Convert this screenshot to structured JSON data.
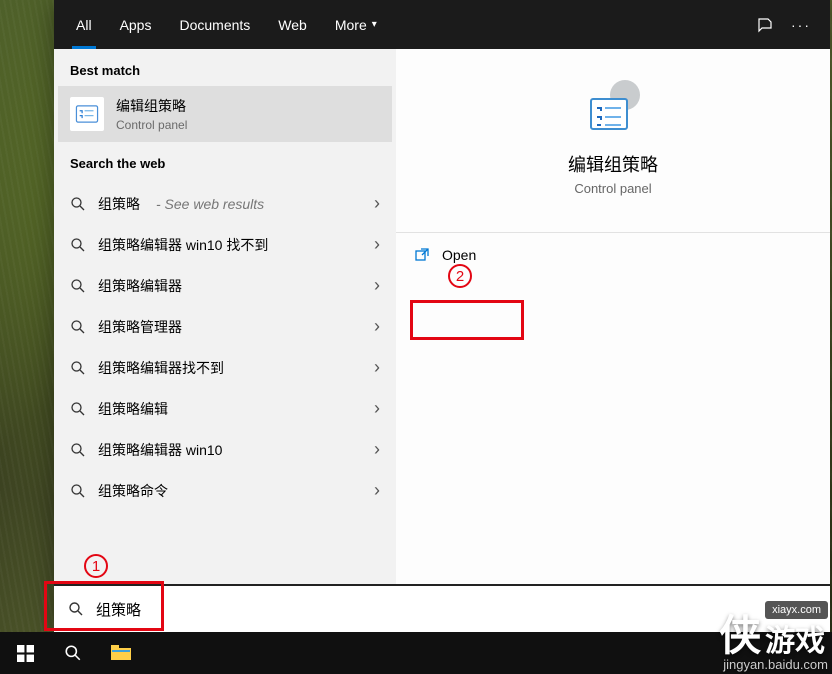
{
  "tabs": {
    "all": "All",
    "apps": "Apps",
    "documents": "Documents",
    "web": "Web",
    "more": "More"
  },
  "sections": {
    "best_match": "Best match",
    "search_web": "Search the web"
  },
  "best_match": {
    "title": "编辑组策略",
    "subtitle": "Control panel"
  },
  "web_results": [
    {
      "label": "组策略",
      "suffix": " - See web results"
    },
    {
      "label": "组策略编辑器 win10 找不到",
      "suffix": ""
    },
    {
      "label": "组策略编辑器",
      "suffix": ""
    },
    {
      "label": "组策略管理器",
      "suffix": ""
    },
    {
      "label": "组策略编辑器找不到",
      "suffix": ""
    },
    {
      "label": "组策略编辑",
      "suffix": ""
    },
    {
      "label": "组策略编辑器 win10",
      "suffix": ""
    },
    {
      "label": "组策略命令",
      "suffix": ""
    }
  ],
  "preview": {
    "title": "编辑组策略",
    "subtitle": "Control panel",
    "open": "Open"
  },
  "search": {
    "value": "组策略"
  },
  "callouts": {
    "one": "1",
    "two": "2"
  },
  "watermark": {
    "brand": "侠",
    "brand2": "游戏",
    "url": "xiayx.com",
    "sub": "jingyan.baidu.com"
  }
}
